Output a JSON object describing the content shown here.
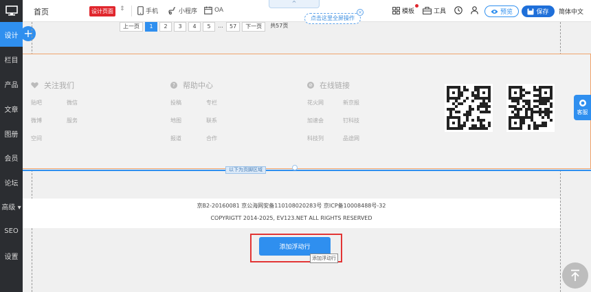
{
  "topbar": {
    "home_label": "首页",
    "page_badge": "设计页面",
    "tools": {
      "mobile": "手机",
      "miniprogram": "小程序",
      "oa": "OA"
    },
    "collapse_arrow": "^",
    "tip_text": "点击这里全屏操作",
    "template_label": "模板",
    "tools_label": "工具",
    "preview_label": "预览",
    "save_label": "保存",
    "language": "简体中文"
  },
  "sidebar": {
    "plus_label": "+",
    "items": [
      {
        "label": "设计",
        "active": true
      },
      {
        "label": "栏目"
      },
      {
        "label": "产品"
      },
      {
        "label": "文章"
      },
      {
        "label": "图册"
      },
      {
        "label": "会员"
      },
      {
        "label": "论坛"
      },
      {
        "label": "高级 ▾"
      },
      {
        "label": "SEO"
      },
      {
        "label": "设置"
      }
    ]
  },
  "pager": {
    "prev": "上一页",
    "pages": [
      "1",
      "2",
      "3",
      "4",
      "5"
    ],
    "ellipsis": "...",
    "last": "57",
    "next": "下一页",
    "total": "共57页"
  },
  "footer": {
    "columns": [
      {
        "title": "关注我们",
        "icon": "heart-icon",
        "links": [
          "贴吧",
          "微信",
          "微博",
          "服务",
          "空间",
          ""
        ]
      },
      {
        "title": "帮助中心",
        "icon": "question-icon",
        "links": [
          "投稿",
          "专栏",
          "地图",
          "联系",
          "报道",
          "合作"
        ]
      },
      {
        "title": "在线链接",
        "icon": "link-icon",
        "links": [
          "花火网",
          "新京报",
          "加速会",
          "钉科技",
          "科技列",
          "品途网"
        ]
      }
    ],
    "region_label": "以下为页脚区域"
  },
  "copyright": {
    "line1": "京B2-20160081 京公海网安备110108020283号 京ICP备10008488号-32",
    "line2": "COPYRIGTT  2014-2025, EV123.NET ALL RIGHTS RESERVED"
  },
  "float": {
    "button_label": "添加浮动行",
    "tooltip": "添加浮动行"
  },
  "side": {
    "kefu_label": "客服"
  },
  "colors": {
    "accent": "#2f8fef",
    "sidebar_bg": "#2b2d31",
    "highlight_red": "#e23434",
    "badge_red": "#e0262d"
  }
}
